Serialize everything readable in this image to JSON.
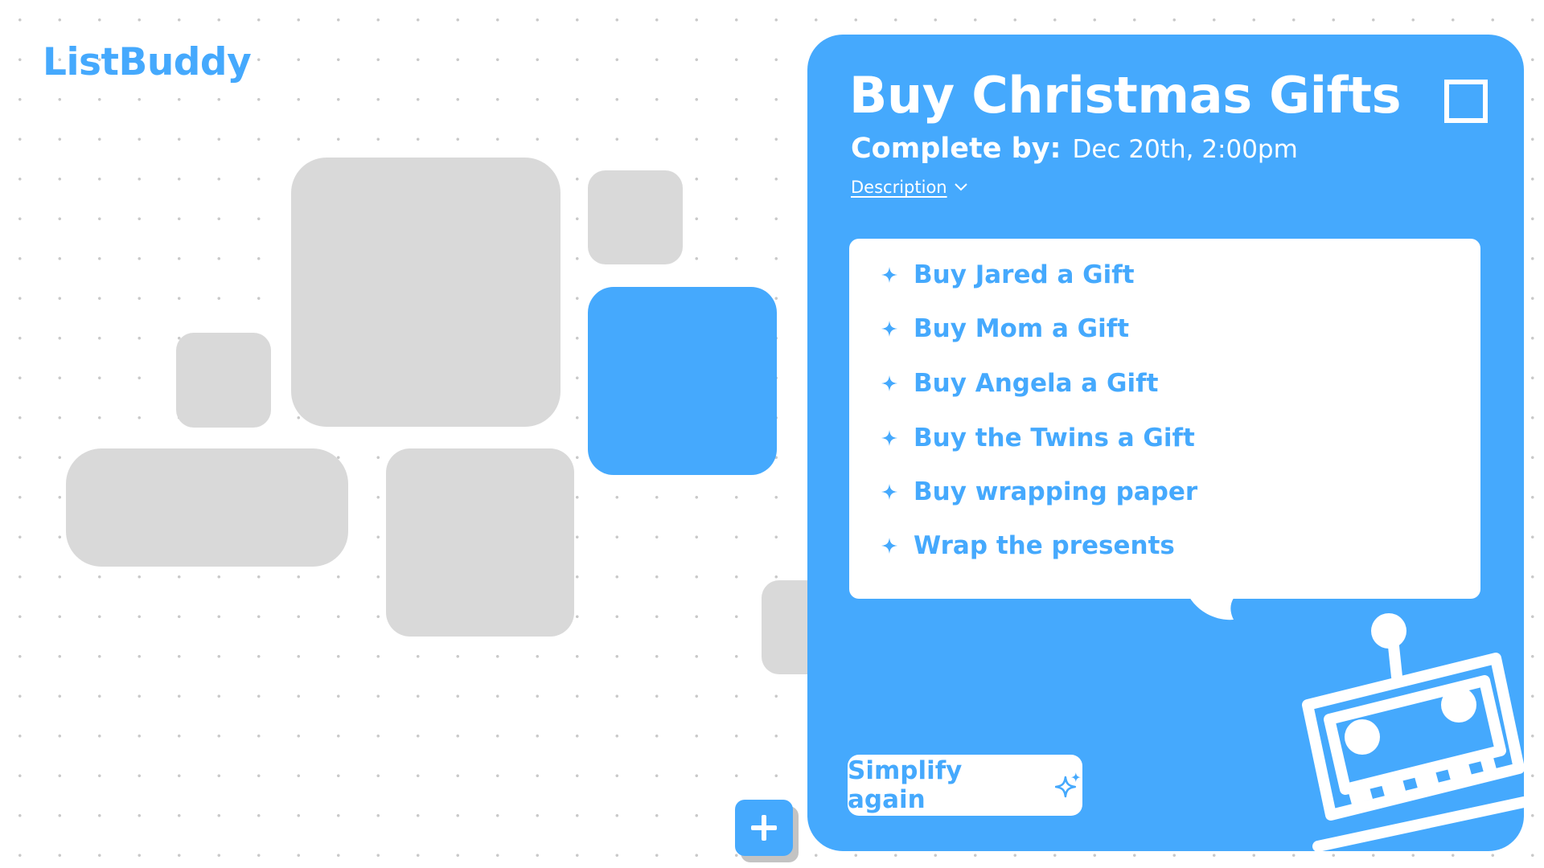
{
  "colors": {
    "accent": "#45a9fd",
    "tile": "#d9d9d9",
    "white": "#ffffff"
  },
  "app": {
    "name": "ListBuddy"
  },
  "add_button": {
    "icon": "plus-icon"
  },
  "task": {
    "title": "Buy Christmas Gifts",
    "complete_label": "Complete by:",
    "complete_value": "Dec 20th, 2:00pm",
    "description_label": "Description",
    "completed": false
  },
  "subtasks": [
    {
      "label": "Buy Jared a Gift",
      "icon": "sparkle-icon"
    },
    {
      "label": "Buy Mom a Gift",
      "icon": "sparkle-icon"
    },
    {
      "label": "Buy Angela a Gift",
      "icon": "sparkle-icon"
    },
    {
      "label": "Buy the Twins a Gift",
      "icon": "sparkle-icon"
    },
    {
      "label": "Buy wrapping paper",
      "icon": "sparkle-icon"
    },
    {
      "label": "Wrap the presents",
      "icon": "sparkle-icon"
    }
  ],
  "simplify": {
    "label": "Simplify again",
    "icon": "sparkles-icon"
  },
  "assistant": {
    "icon": "robot-icon"
  }
}
